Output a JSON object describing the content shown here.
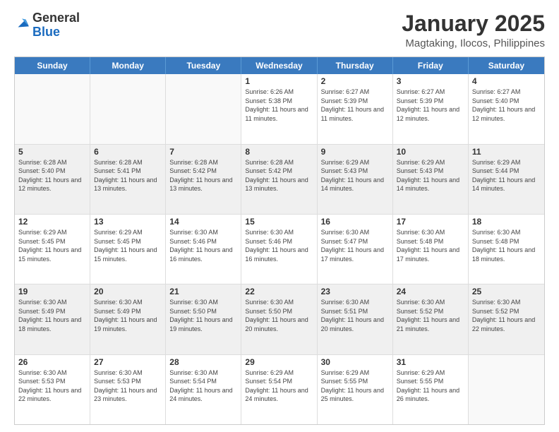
{
  "logo": {
    "general": "General",
    "blue": "Blue"
  },
  "title": "January 2025",
  "subtitle": "Magtaking, Ilocos, Philippines",
  "headers": [
    "Sunday",
    "Monday",
    "Tuesday",
    "Wednesday",
    "Thursday",
    "Friday",
    "Saturday"
  ],
  "weeks": [
    [
      {
        "day": "",
        "sunrise": "",
        "sunset": "",
        "daylight": "",
        "empty": true
      },
      {
        "day": "",
        "sunrise": "",
        "sunset": "",
        "daylight": "",
        "empty": true
      },
      {
        "day": "",
        "sunrise": "",
        "sunset": "",
        "daylight": "",
        "empty": true
      },
      {
        "day": "1",
        "sunrise": "Sunrise: 6:26 AM",
        "sunset": "Sunset: 5:38 PM",
        "daylight": "Daylight: 11 hours and 11 minutes.",
        "empty": false
      },
      {
        "day": "2",
        "sunrise": "Sunrise: 6:27 AM",
        "sunset": "Sunset: 5:39 PM",
        "daylight": "Daylight: 11 hours and 11 minutes.",
        "empty": false
      },
      {
        "day": "3",
        "sunrise": "Sunrise: 6:27 AM",
        "sunset": "Sunset: 5:39 PM",
        "daylight": "Daylight: 11 hours and 12 minutes.",
        "empty": false
      },
      {
        "day": "4",
        "sunrise": "Sunrise: 6:27 AM",
        "sunset": "Sunset: 5:40 PM",
        "daylight": "Daylight: 11 hours and 12 minutes.",
        "empty": false
      }
    ],
    [
      {
        "day": "5",
        "sunrise": "Sunrise: 6:28 AM",
        "sunset": "Sunset: 5:40 PM",
        "daylight": "Daylight: 11 hours and 12 minutes.",
        "empty": false
      },
      {
        "day": "6",
        "sunrise": "Sunrise: 6:28 AM",
        "sunset": "Sunset: 5:41 PM",
        "daylight": "Daylight: 11 hours and 13 minutes.",
        "empty": false
      },
      {
        "day": "7",
        "sunrise": "Sunrise: 6:28 AM",
        "sunset": "Sunset: 5:42 PM",
        "daylight": "Daylight: 11 hours and 13 minutes.",
        "empty": false
      },
      {
        "day": "8",
        "sunrise": "Sunrise: 6:28 AM",
        "sunset": "Sunset: 5:42 PM",
        "daylight": "Daylight: 11 hours and 13 minutes.",
        "empty": false
      },
      {
        "day": "9",
        "sunrise": "Sunrise: 6:29 AM",
        "sunset": "Sunset: 5:43 PM",
        "daylight": "Daylight: 11 hours and 14 minutes.",
        "empty": false
      },
      {
        "day": "10",
        "sunrise": "Sunrise: 6:29 AM",
        "sunset": "Sunset: 5:43 PM",
        "daylight": "Daylight: 11 hours and 14 minutes.",
        "empty": false
      },
      {
        "day": "11",
        "sunrise": "Sunrise: 6:29 AM",
        "sunset": "Sunset: 5:44 PM",
        "daylight": "Daylight: 11 hours and 14 minutes.",
        "empty": false
      }
    ],
    [
      {
        "day": "12",
        "sunrise": "Sunrise: 6:29 AM",
        "sunset": "Sunset: 5:45 PM",
        "daylight": "Daylight: 11 hours and 15 minutes.",
        "empty": false
      },
      {
        "day": "13",
        "sunrise": "Sunrise: 6:29 AM",
        "sunset": "Sunset: 5:45 PM",
        "daylight": "Daylight: 11 hours and 15 minutes.",
        "empty": false
      },
      {
        "day": "14",
        "sunrise": "Sunrise: 6:30 AM",
        "sunset": "Sunset: 5:46 PM",
        "daylight": "Daylight: 11 hours and 16 minutes.",
        "empty": false
      },
      {
        "day": "15",
        "sunrise": "Sunrise: 6:30 AM",
        "sunset": "Sunset: 5:46 PM",
        "daylight": "Daylight: 11 hours and 16 minutes.",
        "empty": false
      },
      {
        "day": "16",
        "sunrise": "Sunrise: 6:30 AM",
        "sunset": "Sunset: 5:47 PM",
        "daylight": "Daylight: 11 hours and 17 minutes.",
        "empty": false
      },
      {
        "day": "17",
        "sunrise": "Sunrise: 6:30 AM",
        "sunset": "Sunset: 5:48 PM",
        "daylight": "Daylight: 11 hours and 17 minutes.",
        "empty": false
      },
      {
        "day": "18",
        "sunrise": "Sunrise: 6:30 AM",
        "sunset": "Sunset: 5:48 PM",
        "daylight": "Daylight: 11 hours and 18 minutes.",
        "empty": false
      }
    ],
    [
      {
        "day": "19",
        "sunrise": "Sunrise: 6:30 AM",
        "sunset": "Sunset: 5:49 PM",
        "daylight": "Daylight: 11 hours and 18 minutes.",
        "empty": false
      },
      {
        "day": "20",
        "sunrise": "Sunrise: 6:30 AM",
        "sunset": "Sunset: 5:49 PM",
        "daylight": "Daylight: 11 hours and 19 minutes.",
        "empty": false
      },
      {
        "day": "21",
        "sunrise": "Sunrise: 6:30 AM",
        "sunset": "Sunset: 5:50 PM",
        "daylight": "Daylight: 11 hours and 19 minutes.",
        "empty": false
      },
      {
        "day": "22",
        "sunrise": "Sunrise: 6:30 AM",
        "sunset": "Sunset: 5:50 PM",
        "daylight": "Daylight: 11 hours and 20 minutes.",
        "empty": false
      },
      {
        "day": "23",
        "sunrise": "Sunrise: 6:30 AM",
        "sunset": "Sunset: 5:51 PM",
        "daylight": "Daylight: 11 hours and 20 minutes.",
        "empty": false
      },
      {
        "day": "24",
        "sunrise": "Sunrise: 6:30 AM",
        "sunset": "Sunset: 5:52 PM",
        "daylight": "Daylight: 11 hours and 21 minutes.",
        "empty": false
      },
      {
        "day": "25",
        "sunrise": "Sunrise: 6:30 AM",
        "sunset": "Sunset: 5:52 PM",
        "daylight": "Daylight: 11 hours and 22 minutes.",
        "empty": false
      }
    ],
    [
      {
        "day": "26",
        "sunrise": "Sunrise: 6:30 AM",
        "sunset": "Sunset: 5:53 PM",
        "daylight": "Daylight: 11 hours and 22 minutes.",
        "empty": false
      },
      {
        "day": "27",
        "sunrise": "Sunrise: 6:30 AM",
        "sunset": "Sunset: 5:53 PM",
        "daylight": "Daylight: 11 hours and 23 minutes.",
        "empty": false
      },
      {
        "day": "28",
        "sunrise": "Sunrise: 6:30 AM",
        "sunset": "Sunset: 5:54 PM",
        "daylight": "Daylight: 11 hours and 24 minutes.",
        "empty": false
      },
      {
        "day": "29",
        "sunrise": "Sunrise: 6:29 AM",
        "sunset": "Sunset: 5:54 PM",
        "daylight": "Daylight: 11 hours and 24 minutes.",
        "empty": false
      },
      {
        "day": "30",
        "sunrise": "Sunrise: 6:29 AM",
        "sunset": "Sunset: 5:55 PM",
        "daylight": "Daylight: 11 hours and 25 minutes.",
        "empty": false
      },
      {
        "day": "31",
        "sunrise": "Sunrise: 6:29 AM",
        "sunset": "Sunset: 5:55 PM",
        "daylight": "Daylight: 11 hours and 26 minutes.",
        "empty": false
      },
      {
        "day": "",
        "sunrise": "",
        "sunset": "",
        "daylight": "",
        "empty": true
      }
    ]
  ]
}
